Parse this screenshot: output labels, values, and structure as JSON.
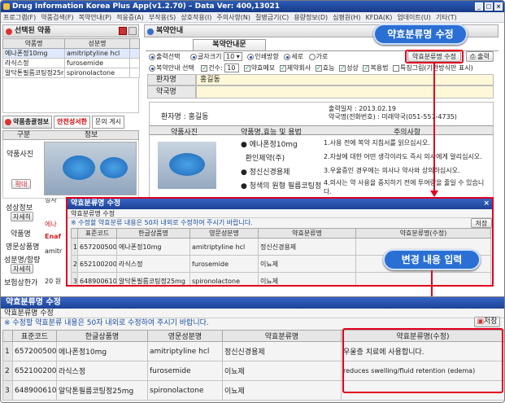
{
  "window": {
    "title": "Drug Information Korea Plus App(v1.2.70) – Data Ver: 400,13021"
  },
  "menu": [
    "프로그램(F)",
    "약품검색(F)",
    "복약안내(P)",
    "적응증(A)",
    "부작용(S)",
    "상호작용(I)",
    "주의사항(N)",
    "질병금기(C)",
    "용량정보(D)",
    "심평원(H)",
    "KFDA(K)",
    "업데이트(U)",
    "기타(T)"
  ],
  "selected_panel": {
    "title": "선택된 약품",
    "columns": [
      "약품명",
      "성분명"
    ],
    "rows": [
      [
        "에나폰정10mg",
        "amitriptyline hcl"
      ],
      [
        "라식스정",
        "furosemide"
      ],
      [
        "알닥톤필름코팅정25r",
        "spironolactone"
      ]
    ]
  },
  "totalinfo": {
    "tab_total": "약품총괄정보",
    "tab_safety": "안전성서한",
    "tab_question": "문의 게시",
    "col_div": "구분",
    "col_info": "정보",
    "label_photo": "약품사진",
    "btn_zoom": "확대",
    "label_ingredient": "성상정보",
    "btn_detail": "자세히",
    "label_name": "약품명",
    "label_ingr_name": "영문상품명",
    "label_dose": "성분명/함량",
    "btn_detail2": "자세히",
    "label_insurance": "보험상한가",
    "snippet_top": "정사",
    "snippet_name": "에나",
    "snippet_eng": "Enaf",
    "snippet_ingr": "amitr",
    "snippet_price": "20 원"
  },
  "guidance": {
    "title": "복약안내",
    "tab": "복약안내문",
    "print_select": "출력선택",
    "font_size_label": "글자크기",
    "font_size_value": "10",
    "print_dir_label": "인쇄방향",
    "dir_vertical": "세로",
    "dir_horizontal": "가로",
    "btn_classification_edit": "약효분류명 수정",
    "btn_print": "출력",
    "guide_select": "복약안내 선택",
    "count_label": "건수",
    "count_value": "10",
    "opt_memo": "약효메모",
    "opt_maker": "제약회사",
    "opt_effect": "효능",
    "opt_shape": "성상",
    "opt_usage": "복용법",
    "opt_extra": "특징그림(기관방식만 표시)",
    "patient_label": "환자명",
    "patient_value": "홍길동",
    "pharmacist_label": "약국명",
    "doc_patient": "환자명 : 홍길동",
    "doc_date": "출력일자  :  2013.02.19",
    "doc_pharmacy": "약국명(전화번호) : 미래약국(051-557-4735)",
    "doc_col_photo": "약품사진",
    "doc_col_name": "약품명,효능 및 용법",
    "doc_col_caution": "주의사항",
    "doc_items": [
      "에나폰정10mg",
      "환인제약(주)",
      "정신신경용제",
      "청색의 원형 필름코팅정"
    ],
    "doc_cautions": [
      "1.사용 전에 복약 지침서를 읽으십시오.",
      "2.자살에 대한 어떤 생각이라도 즉시 의사에게 알리십시오.",
      "3.우울증인 경우에는 의사나 약사와 상의하십시오.",
      "4.의사는 약 사용을 중지하기 전에 투여량을 줄일 수 있습니다."
    ]
  },
  "dialog_small": {
    "title": "약효분류명 수정",
    "section": "약효분류명 수정",
    "hint": "※ 수정할  약효분류 내용은 50자 내외로 수정하여 주시기 바랍니다.",
    "save": "저장",
    "columns": [
      "표준코드",
      "한글상품명",
      "영문성분명",
      "약효분류명",
      "약효분류명(수정)"
    ],
    "rows": [
      [
        "657200500",
        "에나폰정10mg",
        "amitriptyline hcl",
        "정신신경용제",
        ""
      ],
      [
        "652100200",
        "라식스정",
        "furosemide",
        "이뇨제",
        ""
      ],
      [
        "648900610",
        "알닥톤필름코팅정25mg",
        "spironolactone",
        "이뇨제",
        ""
      ]
    ]
  },
  "dialog_big": {
    "title": "약효분류명 수정",
    "section": "약효분류명 수정",
    "hint": "※ 수정할  약효분류 내용은 50자 내외로 수정하여 주시기 바랍니다.",
    "save": "저장",
    "columns": [
      "표준코드",
      "한글상품명",
      "영문성분명",
      "약효분류명",
      "약효분류명(수정)"
    ],
    "rows": [
      [
        "657200500",
        "에나폰정10mg",
        "amitriptyline hcl",
        "정신신경용제",
        "우울증 치료에 사용합니다."
      ],
      [
        "652100200",
        "라식스정",
        "furosemide",
        "이뇨제",
        "reduces swelling/fluid retention (edema)"
      ],
      [
        "648900610",
        "알닥톤필름코팅정25mg",
        "spironolactone",
        "이뇨제",
        ""
      ]
    ]
  },
  "callouts": {
    "edit_name": "약효분류명 수정",
    "enter_change": "변경 내용 입력"
  },
  "colors": {
    "callout_blue": "#2a6fd3",
    "highlight_red": "#e1001f",
    "title_blue": "#1c4396"
  }
}
